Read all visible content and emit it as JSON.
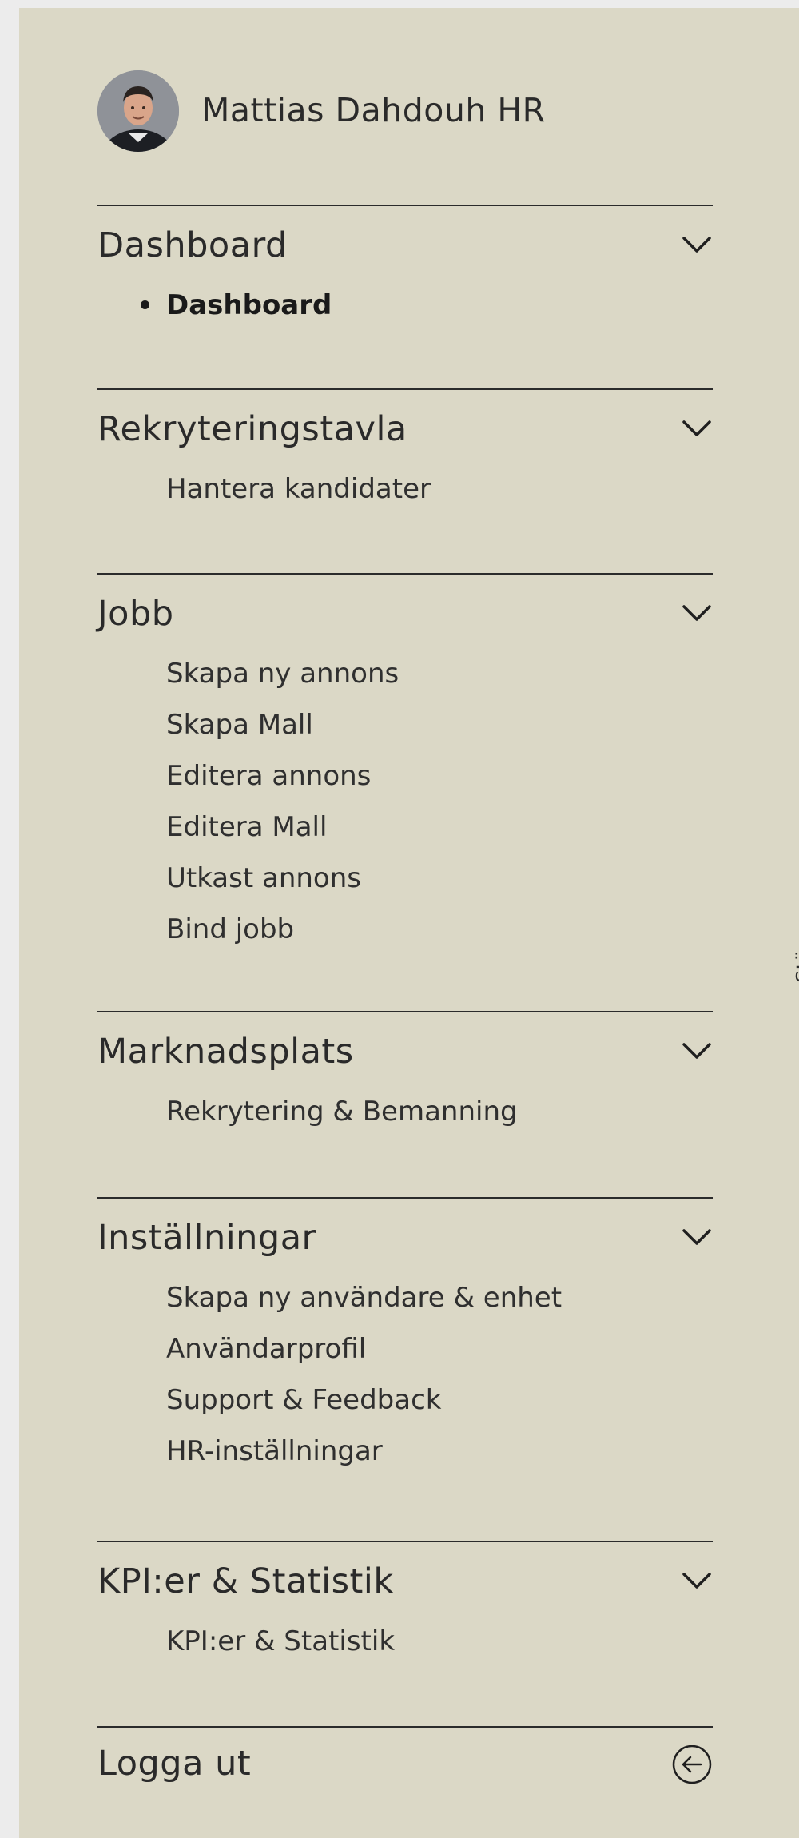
{
  "profile": {
    "name": "Mattias Dahdouh HR"
  },
  "close_label": "Stäng",
  "sections": [
    {
      "title": "Dashboard",
      "items": [
        "Dashboard"
      ]
    },
    {
      "title": "Rekryteringstavla",
      "items": [
        "Hantera kandidater"
      ]
    },
    {
      "title": "Jobb",
      "items": [
        "Skapa ny annons",
        "Skapa Mall",
        "Editera annons",
        "Editera Mall",
        "Utkast annons",
        "Bind jobb"
      ]
    },
    {
      "title": "Marknadsplats",
      "items": [
        "Rekrytering & Bemanning"
      ]
    },
    {
      "title": "Inställningar",
      "items": [
        "Skapa ny användare & enhet",
        "Användarprofil",
        "Support & Feedback",
        "HR-inställningar"
      ]
    },
    {
      "title": "KPI:er & Statistik",
      "items": [
        "KPI:er & Statistik"
      ]
    }
  ],
  "logout": {
    "label": "Logga ut"
  },
  "icons": {
    "section_toggle": "chevron-down-icon",
    "logout": "arrow-left-circle-icon"
  },
  "colors": {
    "panel_background": "#dbd8c6",
    "page_background": "#ececec",
    "text": "#2a2a2a"
  }
}
